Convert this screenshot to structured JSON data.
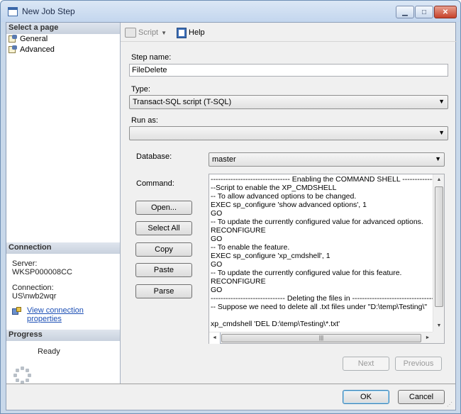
{
  "window": {
    "title": "New Job Step"
  },
  "left": {
    "select_page_header": "Select a page",
    "pages": [
      {
        "label": "General",
        "icon": "page-properties-icon"
      },
      {
        "label": "Advanced",
        "icon": "page-properties-icon"
      }
    ],
    "connection_header": "Connection",
    "server_label": "Server:",
    "server_value": "WKSP000008CC",
    "connection_label": "Connection:",
    "connection_value": "US\\nwb2wqr",
    "view_connection_link": "View connection properties",
    "progress_header": "Progress",
    "progress_status": "Ready"
  },
  "toolbar": {
    "script_label": "Script",
    "help_label": "Help"
  },
  "form": {
    "step_name_label": "Step name:",
    "step_name_value": "FileDelete",
    "type_label": "Type:",
    "type_value": "Transact-SQL script (T-SQL)",
    "run_as_label": "Run as:",
    "run_as_value": "",
    "database_label": "Database:",
    "database_value": "master",
    "command_label": "Command:",
    "command_lines": [
      "-------------------------------- Enabling the COMMAND SHELL ---------------------------",
      "--Script to enable the XP_CMDSHELL",
      "-- To allow advanced options to be changed.",
      "EXEC sp_configure 'show advanced options', 1",
      "GO",
      "-- To update the currently configured value for advanced options.",
      "RECONFIGURE",
      "GO",
      "-- To enable the feature.",
      "EXEC sp_configure 'xp_cmdshell', 1",
      "GO",
      "-- To update the currently configured value for this feature.",
      "RECONFIGURE",
      "GO",
      "------------------------------ Deleting the files in ----------------------------------",
      "-- Suppose we need to delete all .txt files under \"D:\\temp\\Testing\\\"",
      "",
      "xp_cmdshell 'DEL D:\\temp\\Testing\\*.txt'"
    ]
  },
  "buttons": {
    "open": "Open...",
    "select_all": "Select All",
    "copy": "Copy",
    "paste": "Paste",
    "parse": "Parse",
    "next": "Next",
    "previous": "Previous",
    "ok": "OK",
    "cancel": "Cancel"
  }
}
